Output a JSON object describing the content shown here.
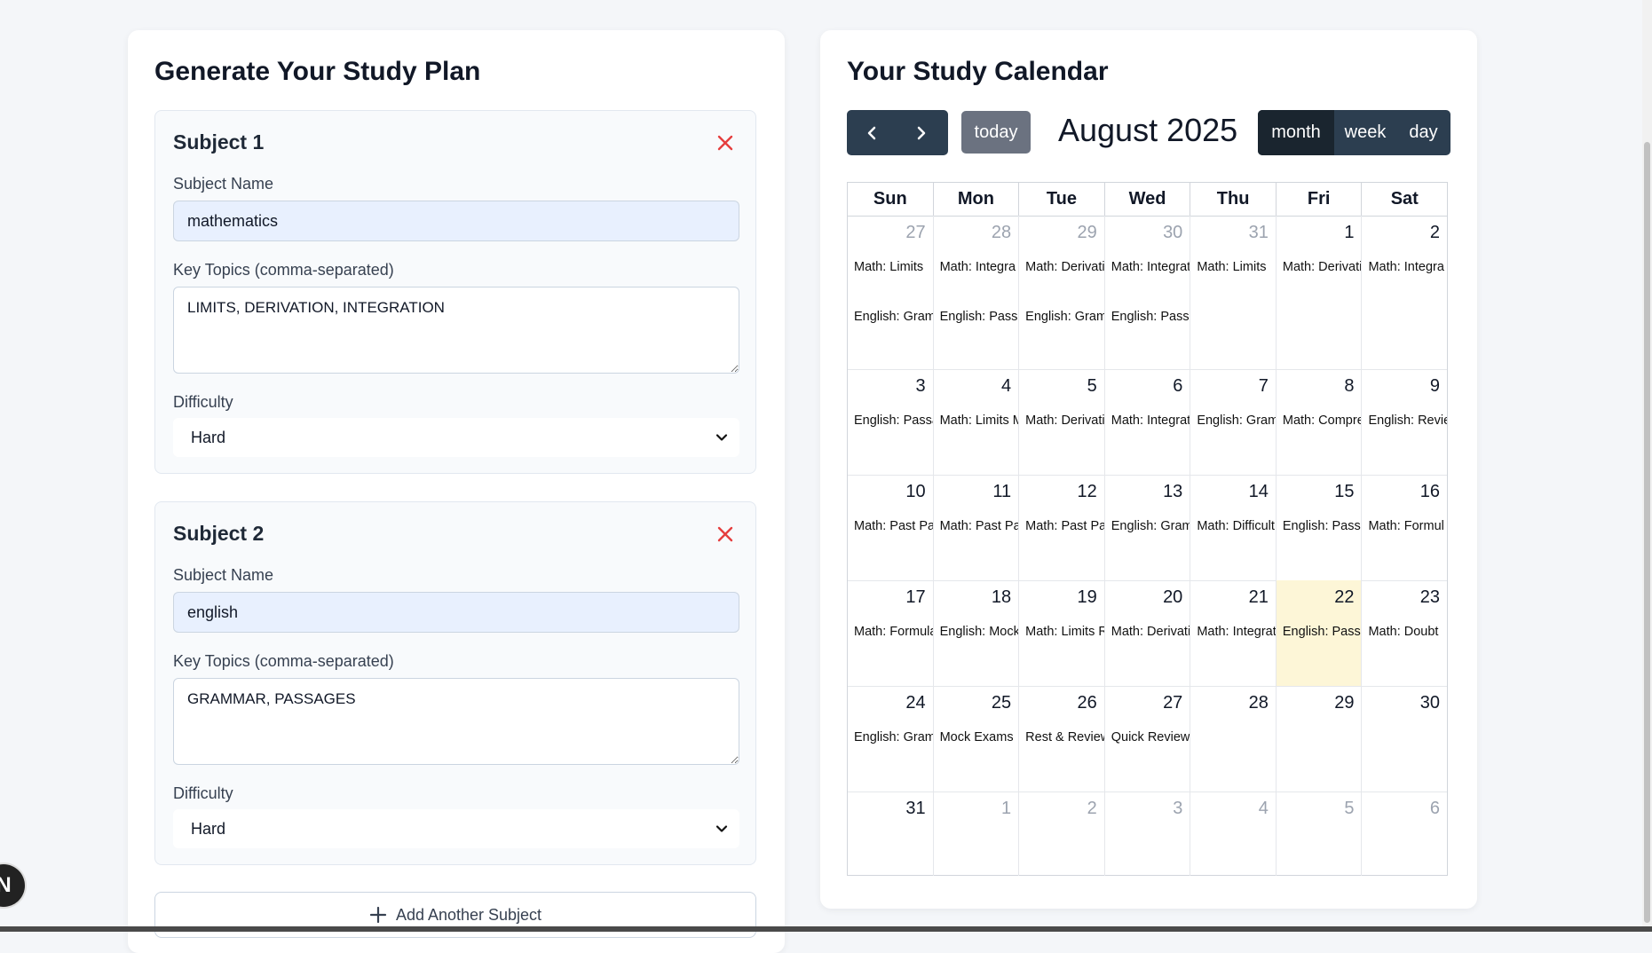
{
  "form": {
    "title": "Generate Your Study Plan",
    "subjects": [
      {
        "title": "Subject 1",
        "name_label": "Subject Name",
        "name_value": "mathematics",
        "topics_label": "Key Topics (comma-separated)",
        "topics_value": "LIMITS, DERIVATION, INTEGRATION",
        "difficulty_label": "Difficulty",
        "difficulty_value": "Hard"
      },
      {
        "title": "Subject 2",
        "name_label": "Subject Name",
        "name_value": "english",
        "topics_label": "Key Topics (comma-separated)",
        "topics_value": "GRAMMAR, PASSAGES",
        "difficulty_label": "Difficulty",
        "difficulty_value": "Hard"
      }
    ],
    "add_subject_label": "Add Another Subject"
  },
  "calendar": {
    "title": "Your Study Calendar",
    "today_label": "today",
    "month_title": "August 2025",
    "views": [
      "month",
      "week",
      "day"
    ],
    "active_view": "month",
    "days_of_week": [
      "Sun",
      "Mon",
      "Tue",
      "Wed",
      "Thu",
      "Fri",
      "Sat"
    ],
    "today_date": "22",
    "weeks": [
      [
        {
          "date": "27",
          "other": true,
          "events": [
            "Math: Limits",
            "English: Gramm"
          ]
        },
        {
          "date": "28",
          "other": true,
          "events": [
            "Math: Integra",
            "English: Passages"
          ]
        },
        {
          "date": "29",
          "other": true,
          "events": [
            "Math: Derivatio",
            "English: Grammar"
          ]
        },
        {
          "date": "30",
          "other": true,
          "events": [
            "Math: Integrati",
            "English: Passages"
          ]
        },
        {
          "date": "31",
          "other": true,
          "events": [
            "Math: Limits"
          ]
        },
        {
          "date": "1",
          "other": false,
          "events": [
            "Math: Derivatio"
          ]
        },
        {
          "date": "2",
          "other": false,
          "events": [
            "Math: Integra"
          ]
        }
      ],
      [
        {
          "date": "3",
          "other": false,
          "events": [
            "English: Passag"
          ]
        },
        {
          "date": "4",
          "other": false,
          "events": [
            "Math: Limits Mock"
          ]
        },
        {
          "date": "5",
          "other": false,
          "events": [
            "Math: Derivatio"
          ]
        },
        {
          "date": "6",
          "other": false,
          "events": [
            "Math: Integration Mock"
          ]
        },
        {
          "date": "7",
          "other": false,
          "events": [
            "English: Grammar Mock"
          ]
        },
        {
          "date": "8",
          "other": false,
          "events": [
            "Math: Comprehensive"
          ]
        },
        {
          "date": "9",
          "other": false,
          "events": [
            "English: Revie"
          ]
        }
      ],
      [
        {
          "date": "10",
          "other": false,
          "events": [
            "Math: Past Pape"
          ]
        },
        {
          "date": "11",
          "other": false,
          "events": [
            "Math: Past Pape"
          ]
        },
        {
          "date": "12",
          "other": false,
          "events": [
            "Math: Past Pape"
          ]
        },
        {
          "date": "13",
          "other": false,
          "events": [
            "English: Grammar"
          ]
        },
        {
          "date": "14",
          "other": false,
          "events": [
            "Math: Difficult Problems"
          ]
        },
        {
          "date": "15",
          "other": false,
          "events": [
            "English: Passage Practice"
          ]
        },
        {
          "date": "16",
          "other": false,
          "events": [
            "Math: Formul"
          ]
        }
      ],
      [
        {
          "date": "17",
          "other": false,
          "events": [
            "Math: Formula"
          ]
        },
        {
          "date": "18",
          "other": false,
          "events": [
            "English: Mock Exam"
          ]
        },
        {
          "date": "19",
          "other": false,
          "events": [
            "Math: Limits Review"
          ]
        },
        {
          "date": "20",
          "other": false,
          "events": [
            "Math: Derivation Review"
          ]
        },
        {
          "date": "21",
          "other": false,
          "events": [
            "Math: Integration Review"
          ]
        },
        {
          "date": "22",
          "other": false,
          "events": [
            "English: Passage Drill"
          ]
        },
        {
          "date": "23",
          "other": false,
          "events": [
            "Math: Doubt"
          ]
        }
      ],
      [
        {
          "date": "24",
          "other": false,
          "events": [
            "English: Gramm"
          ]
        },
        {
          "date": "25",
          "other": false,
          "events": [
            "Mock Exams"
          ]
        },
        {
          "date": "26",
          "other": false,
          "events": [
            "Rest & Review"
          ]
        },
        {
          "date": "27",
          "other": false,
          "events": [
            "Quick Review"
          ]
        },
        {
          "date": "28",
          "other": false,
          "events": []
        },
        {
          "date": "29",
          "other": false,
          "events": []
        },
        {
          "date": "30",
          "other": false,
          "events": []
        }
      ],
      [
        {
          "date": "31",
          "other": false,
          "events": []
        },
        {
          "date": "1",
          "other": true,
          "events": []
        },
        {
          "date": "2",
          "other": true,
          "events": []
        },
        {
          "date": "3",
          "other": true,
          "events": []
        },
        {
          "date": "4",
          "other": true,
          "events": []
        },
        {
          "date": "5",
          "other": true,
          "events": []
        },
        {
          "date": "6",
          "other": true,
          "events": []
        }
      ]
    ]
  },
  "badge": {
    "label": "N"
  },
  "colors": {
    "primary_dark": "#2c3e50",
    "active_view": "#1a252f",
    "today_button": "#6b7280",
    "today_highlight": "#fdf6d7",
    "remove_icon": "#e53e3e",
    "input_autofill": "#e8f0fe"
  }
}
